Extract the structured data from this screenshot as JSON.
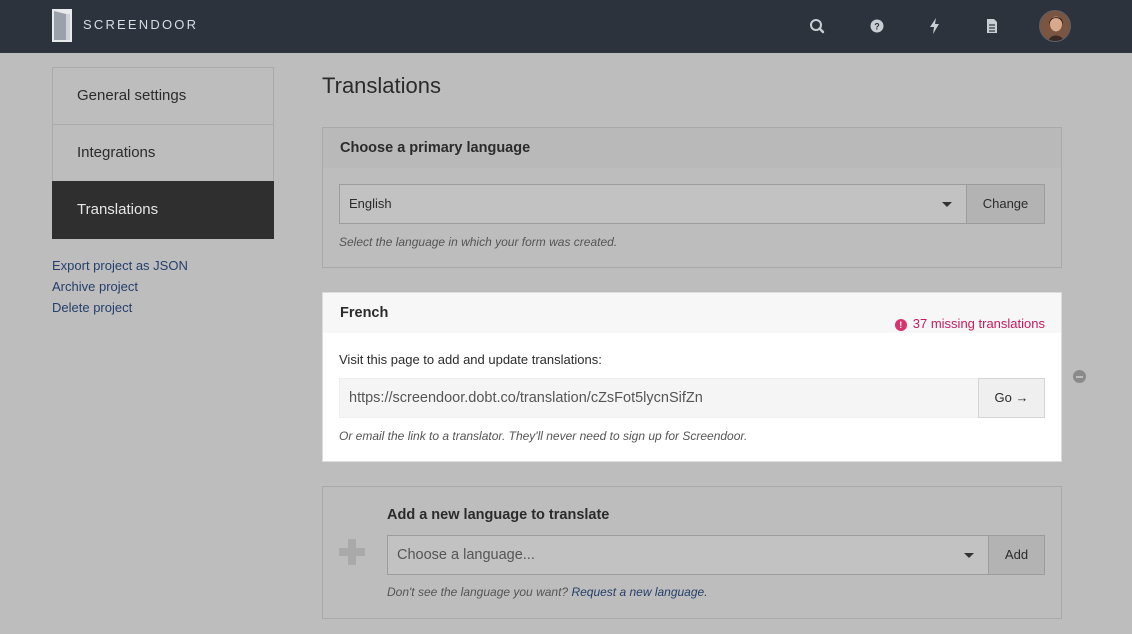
{
  "header": {
    "brand": "SCREENDOOR",
    "icons": [
      "search-icon",
      "help-icon",
      "bolt-icon",
      "document-icon"
    ]
  },
  "sidebar": {
    "items": [
      {
        "label": "General settings"
      },
      {
        "label": "Integrations"
      },
      {
        "label": "Translations"
      }
    ],
    "links": [
      {
        "label": "Export project as JSON"
      },
      {
        "label": "Archive project"
      },
      {
        "label": "Delete project"
      }
    ]
  },
  "main": {
    "title": "Translations",
    "primary": {
      "heading": "Choose a primary language",
      "selected": "English",
      "button": "Change",
      "hint": "Select the language in which your form was created."
    },
    "french": {
      "heading": "French",
      "missing": "37 missing translations",
      "instructions": "Visit this page to add and update translations:",
      "url": "https://screendoor.dobt.co/translation/cZsFot5lycnSifZn",
      "go": "Go →",
      "hint": "Or email the link to a translator. They'll never need to sign up for Screendoor."
    },
    "add": {
      "heading": "Add a new language to translate",
      "placeholder": "Choose a language...",
      "button": "Add",
      "hint_prefix": "Don't see the language you want?",
      "hint_link": "Request a new language."
    }
  },
  "colors": {
    "topbar": "#2c333d",
    "accent_missing": "#c8195e",
    "link": "#243f6a"
  }
}
